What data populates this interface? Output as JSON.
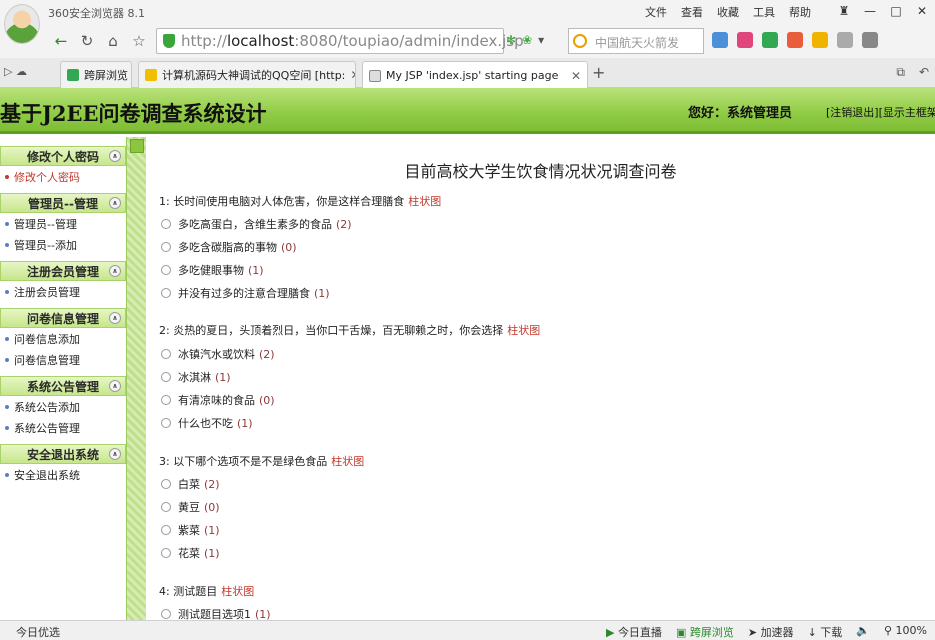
{
  "browser": {
    "app_title": "360安全浏览器 8.1",
    "menu": [
      "文件",
      "查看",
      "收藏",
      "工具",
      "帮助"
    ],
    "url_prefix": "http://",
    "url_host": "localhost",
    "url_rest": ":8080/toupiao/admin/index.jsp",
    "search_placeholder": "中国航天火箭发",
    "tabs": [
      {
        "label": "跨屏浏览"
      },
      {
        "label": "计算机源码大神调试的QQ空间 [http:"
      },
      {
        "label": "My JSP 'index.jsp' starting page"
      }
    ],
    "status_left": "今日优选",
    "status_items": [
      "今日直播",
      "跨屏浏览",
      "加速器",
      "下载",
      "100%"
    ]
  },
  "header": {
    "site_title": "基于J2EE问卷调查系统设计",
    "greeting": "您好：系统管理员",
    "logout": "[注销退出]",
    "show_frame": "[显示主框架"
  },
  "sidebar": {
    "sections": [
      {
        "title": "修改个人密码",
        "items": [
          "修改个人密码"
        ]
      },
      {
        "title": "管理员--管理",
        "items": [
          "管理员--管理",
          "管理员--添加"
        ]
      },
      {
        "title": "注册会员管理",
        "items": [
          "注册会员管理"
        ]
      },
      {
        "title": "问卷信息管理",
        "items": [
          "问卷信息添加",
          "问卷信息管理"
        ]
      },
      {
        "title": "系统公告管理",
        "items": [
          "系统公告添加",
          "系统公告管理"
        ]
      },
      {
        "title": "安全退出系统",
        "items": [
          "安全退出系统"
        ]
      }
    ]
  },
  "survey": {
    "title": "目前高校大学生饮食情况状况调查问卷",
    "chart_link": "柱状图",
    "questions": [
      {
        "text": "1: 长时间使用电脑对人体危害，你是这样合理膳食",
        "options": [
          {
            "text": "多吃高蛋白，含维生素多的食品",
            "count": "(2)"
          },
          {
            "text": "多吃含碳脂高的事物",
            "count": "(0)"
          },
          {
            "text": "多吃健眼事物",
            "count": "(1)"
          },
          {
            "text": "并没有过多的注意合理膳食",
            "count": "(1)"
          }
        ]
      },
      {
        "text": "2: 炎热的夏日，头顶着烈日，当你口干舌燥，百无聊赖之时，你会选择",
        "options": [
          {
            "text": "冰镇汽水或饮料",
            "count": "(2)"
          },
          {
            "text": "冰淇淋",
            "count": "(1)"
          },
          {
            "text": "有清凉味的食品",
            "count": "(0)"
          },
          {
            "text": "什么也不吃",
            "count": "(1)"
          }
        ]
      },
      {
        "text": "3: 以下哪个选项不是不是绿色食品",
        "options": [
          {
            "text": "白菜",
            "count": "(2)"
          },
          {
            "text": "黄豆",
            "count": "(0)"
          },
          {
            "text": "紫菜",
            "count": "(1)"
          },
          {
            "text": "花菜",
            "count": "(1)"
          }
        ]
      },
      {
        "text": "4: 测试题目",
        "options": [
          {
            "text": "测试题目选项1",
            "count": "(1)"
          }
        ]
      }
    ]
  }
}
